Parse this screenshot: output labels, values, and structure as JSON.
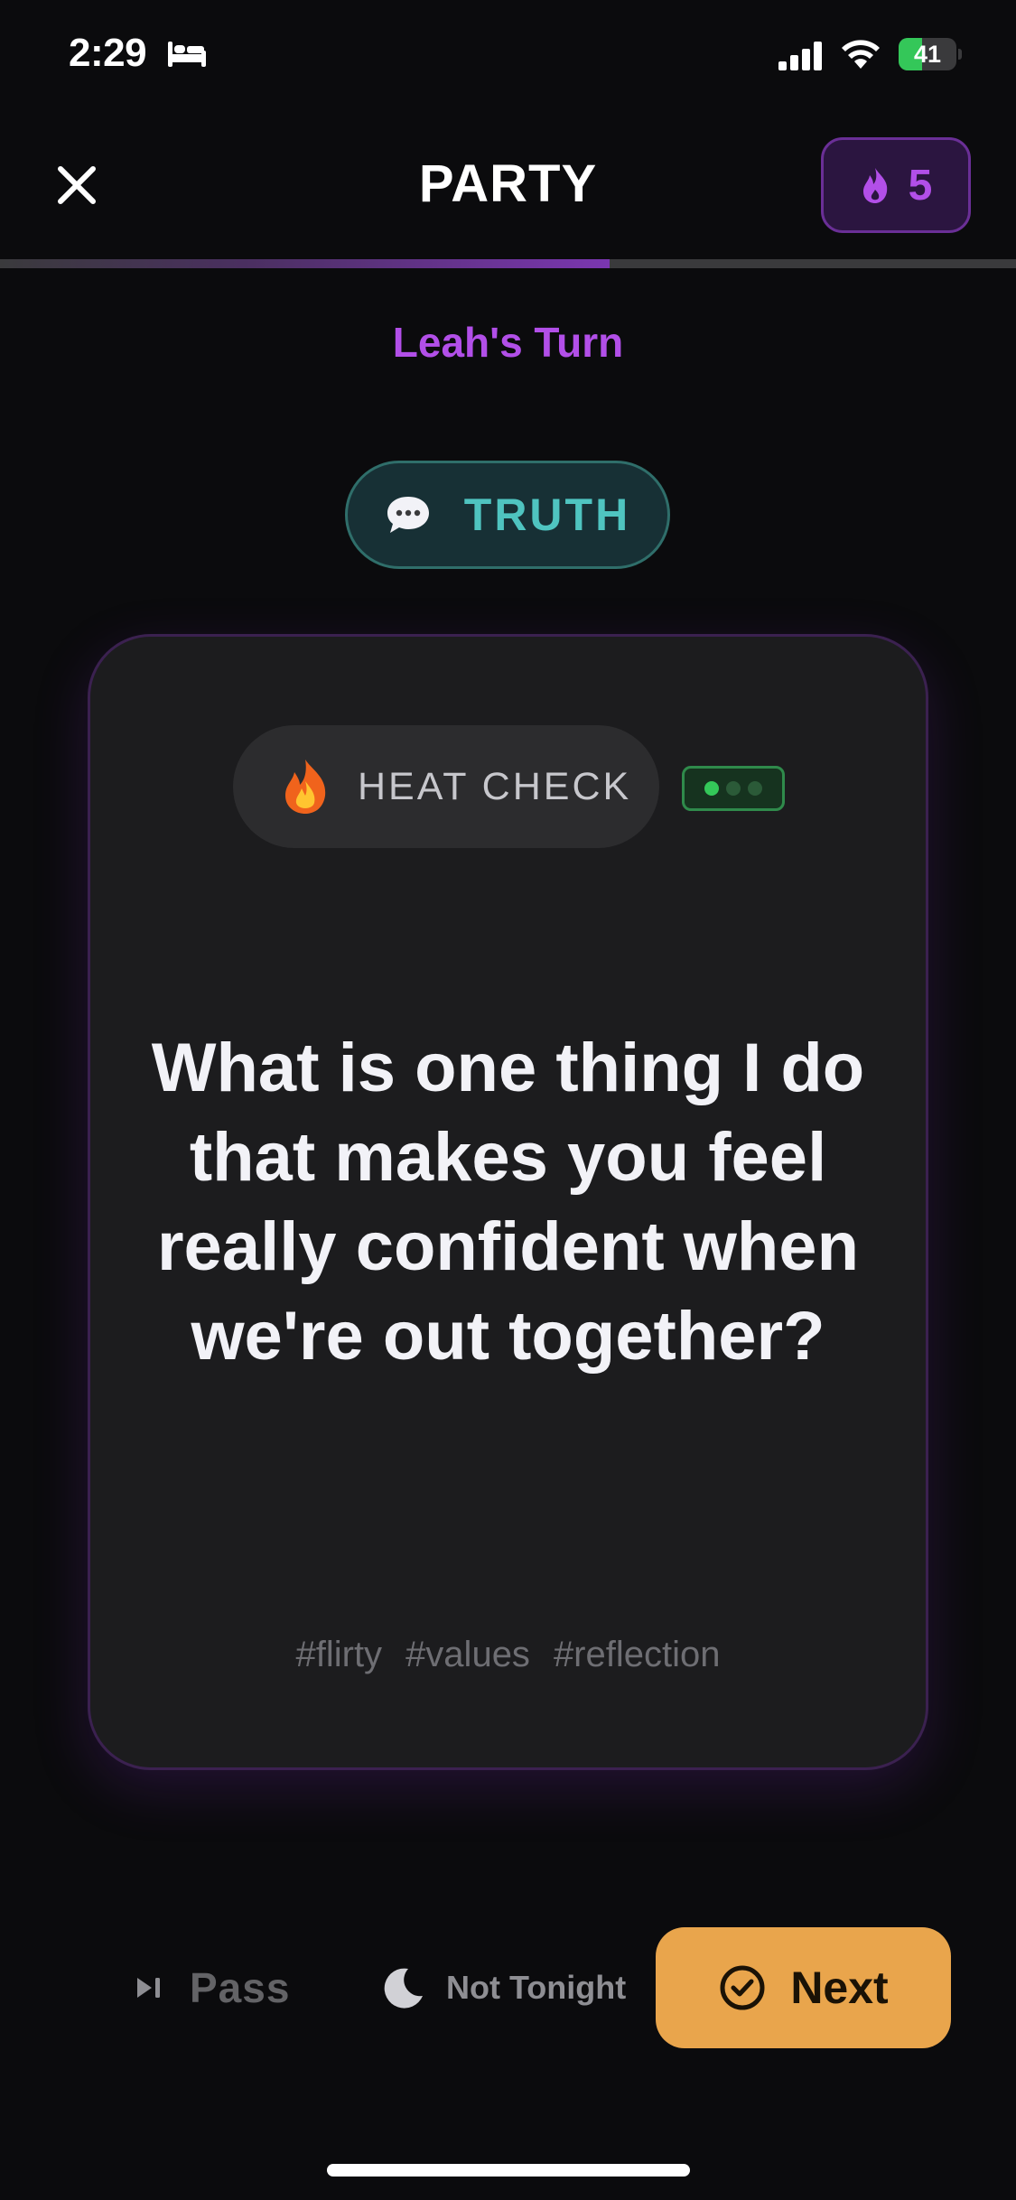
{
  "status_bar": {
    "time": "2:29",
    "battery_percent": 41,
    "battery_label": "41"
  },
  "header": {
    "title": "PARTY",
    "heat_count": "5"
  },
  "progress": {
    "fraction": 0.6
  },
  "turn": {
    "label": "Leah's Turn"
  },
  "prompt_type": {
    "label": "TRUTH"
  },
  "card": {
    "heat_check_label": "HEAT CHECK",
    "intensity_level": 1,
    "intensity_max": 3,
    "question": "What is one thing I do that makes you feel really confident when we're out together?",
    "tags": [
      "#flirty",
      "#values",
      "#reflection"
    ]
  },
  "actions": {
    "pass_label": "Pass",
    "not_tonight_label": "Not Tonight",
    "next_label": "Next"
  },
  "colors": {
    "accent_purple": "#b24fe8",
    "truth_teal": "#4fc4c0",
    "next_orange": "#e9a54c",
    "intensity_green": "#34c759"
  }
}
